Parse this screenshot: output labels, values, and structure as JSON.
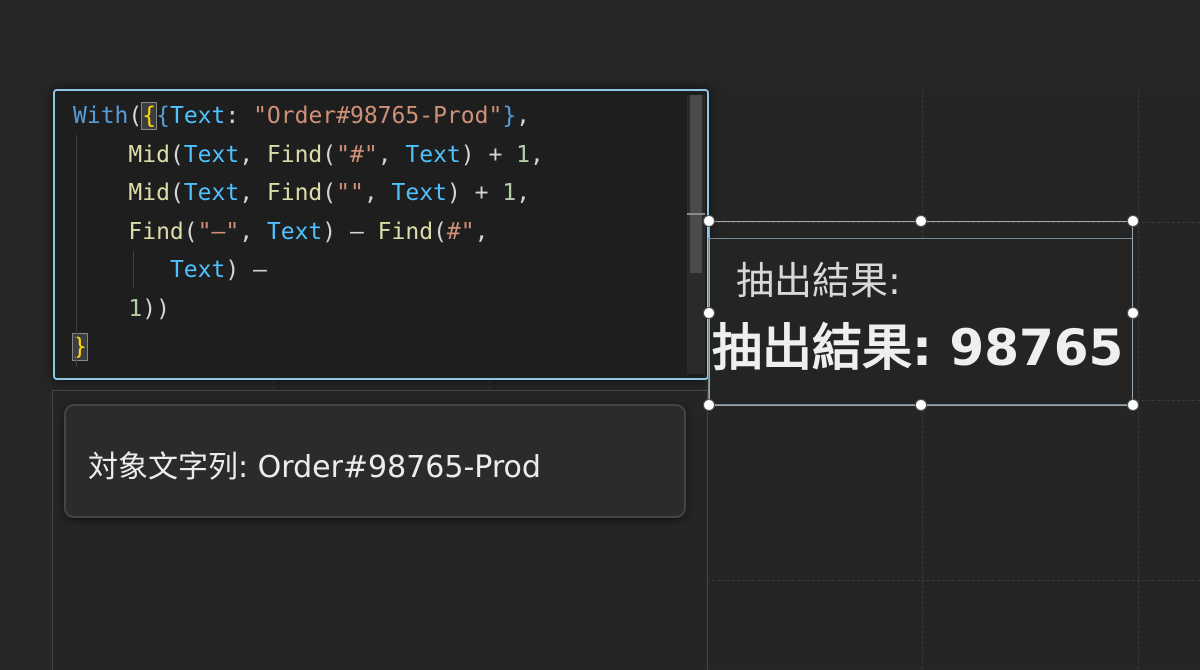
{
  "editor": {
    "lines": [
      [
        {
          "t": "With",
          "c": "kw"
        },
        {
          "t": "(",
          "c": "pn"
        },
        {
          "t": "{",
          "c": "brk brk-hl"
        },
        {
          "t": "{",
          "c": "brk2"
        },
        {
          "t": "Text",
          "c": "var"
        },
        {
          "t": ": ",
          "c": "pn"
        },
        {
          "t": "\"Order#98765-Prod\"",
          "c": "str"
        },
        {
          "t": "}",
          "c": "brk2"
        },
        {
          "t": ",",
          "c": "pn"
        }
      ],
      [
        {
          "t": "    ",
          "c": "pn"
        },
        {
          "t": "Mid",
          "c": "fn"
        },
        {
          "t": "(",
          "c": "pn"
        },
        {
          "t": "Text",
          "c": "var"
        },
        {
          "t": ", ",
          "c": "pn"
        },
        {
          "t": "Find",
          "c": "fn"
        },
        {
          "t": "(",
          "c": "pn"
        },
        {
          "t": "\"#\"",
          "c": "str"
        },
        {
          "t": ", ",
          "c": "pn"
        },
        {
          "t": "Text",
          "c": "var"
        },
        {
          "t": ") + ",
          "c": "pn"
        },
        {
          "t": "1",
          "c": "num"
        },
        {
          "t": ",",
          "c": "pn"
        }
      ],
      [
        {
          "t": "    ",
          "c": "pn"
        },
        {
          "t": "Mid",
          "c": "fn"
        },
        {
          "t": "(",
          "c": "pn"
        },
        {
          "t": "Text",
          "c": "var"
        },
        {
          "t": ", ",
          "c": "pn"
        },
        {
          "t": "Find",
          "c": "fn"
        },
        {
          "t": "(",
          "c": "pn"
        },
        {
          "t": "\"\"",
          "c": "str"
        },
        {
          "t": ", ",
          "c": "pn"
        },
        {
          "t": "Text",
          "c": "var"
        },
        {
          "t": ") + ",
          "c": "pn"
        },
        {
          "t": "1",
          "c": "num"
        },
        {
          "t": ",",
          "c": "pn"
        }
      ],
      [
        {
          "t": "    ",
          "c": "pn"
        },
        {
          "t": "Find",
          "c": "fn"
        },
        {
          "t": "(",
          "c": "pn"
        },
        {
          "t": "\"–\"",
          "c": "str"
        },
        {
          "t": ", ",
          "c": "pn"
        },
        {
          "t": "Text",
          "c": "var"
        },
        {
          "t": ") – ",
          "c": "pn"
        },
        {
          "t": "Find",
          "c": "fn"
        },
        {
          "t": "(",
          "c": "pn"
        },
        {
          "t": "#\"",
          "c": "str"
        },
        {
          "t": ",",
          "c": "pn"
        }
      ],
      [
        {
          "t": "       ",
          "c": "pn"
        },
        {
          "t": "Text",
          "c": "var"
        },
        {
          "t": ") –",
          "c": "pn"
        }
      ],
      [
        {
          "t": "    ",
          "c": "pn"
        },
        {
          "t": "1",
          "c": "num"
        },
        {
          "t": "))",
          "c": "pn"
        }
      ],
      [
        {
          "t": "}",
          "c": "brk brk-hl"
        }
      ]
    ]
  },
  "target_label": {
    "text": "対象文字列: Order#98765-Prod"
  },
  "result": {
    "label_small": "抽出結果:",
    "label_big": "抽出結果: 98765"
  },
  "colors": {
    "editor_border": "#8ec6e6",
    "background": "#262626",
    "keyword": "#569cd6",
    "function": "#dcdcaa",
    "string": "#ce9178",
    "variable": "#4fc1ff",
    "number": "#b5cea8",
    "bracket": "#ffd700"
  }
}
